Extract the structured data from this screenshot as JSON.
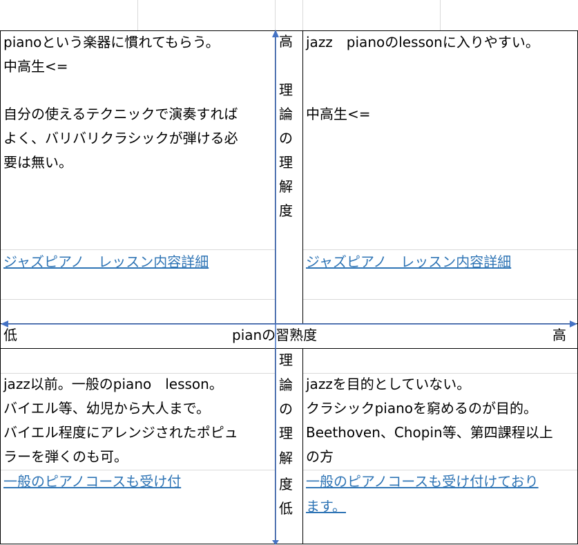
{
  "axis_top_label": [
    "高",
    "理",
    "論",
    "の",
    "理",
    "解",
    "度"
  ],
  "axis_bottom_label": [
    "理",
    "論",
    "の",
    "理",
    "解",
    "度",
    "低"
  ],
  "axis_horizontal": {
    "left": "低",
    "center": "pianの習熟度",
    "right": "高"
  },
  "quadrants": {
    "top_left": {
      "lines": [
        "pianoという楽器に慣れてもらう。",
        "中高生<=",
        "",
        "自分の使えるテクニックで演奏すれば",
        "よく、バリバリクラシックが弾ける必",
        "要は無い。"
      ],
      "link": "ジャズピアノ　レッスン内容詳細"
    },
    "top_right": {
      "lines": [
        "jazz　pianoのlessonに入りやすい。",
        "",
        "",
        "中高生<="
      ],
      "link": "ジャズピアノ　レッスン内容詳細"
    },
    "bottom_left": {
      "lines": [
        "jazz以前。一般のpiano　lesson。",
        "バイエル等、幼児から大人まで。",
        "バイエル程度にアレンジされたポピュ",
        "ラーを弾くのも可。"
      ],
      "link": "一般のピアノコースも受け付"
    },
    "bottom_right": {
      "lines": [
        "jazzを目的としていない。",
        "クラシックpianoを窮めるのが目的。",
        "Beethoven、Chopin等、第四課程以上",
        "の方"
      ],
      "link_lines": [
        "一般のピアノコースも受け付けており",
        "ます。"
      ]
    }
  },
  "colors": {
    "axis": "#4472c4",
    "link": "#2e74b5",
    "gridline": "#d9d9d9",
    "border": "#000000"
  }
}
